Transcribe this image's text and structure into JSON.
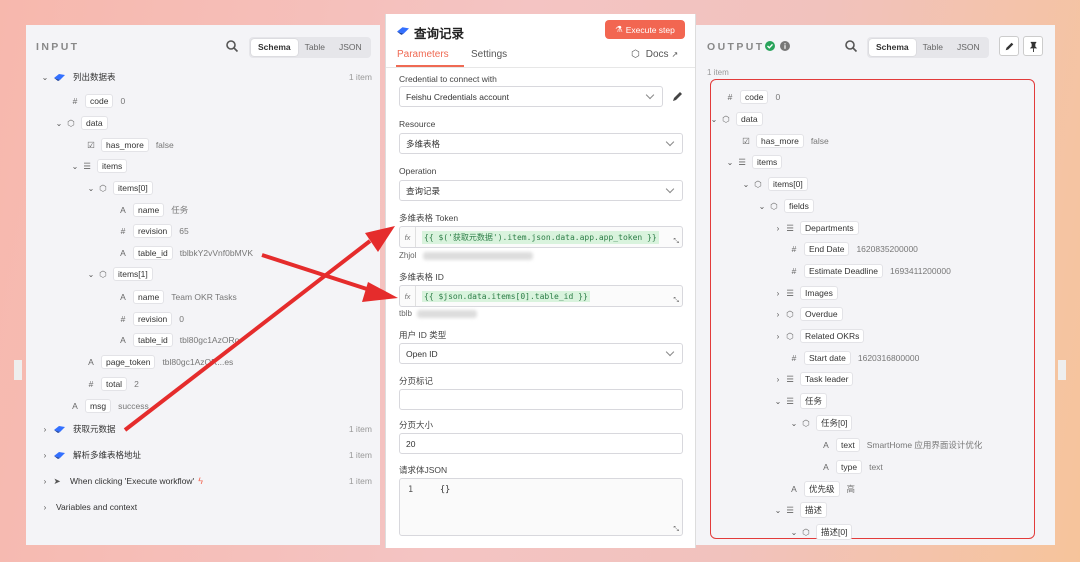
{
  "input": {
    "title": "INPUT",
    "views": [
      "Schema",
      "Table",
      "JSON"
    ],
    "nodes": [
      {
        "label": "列出数据表",
        "count": "1 item"
      },
      {
        "label": "获取元数据",
        "count": "1 item"
      },
      {
        "label": "解析多维表格地址",
        "count": "1 item"
      },
      {
        "label": "When clicking 'Execute workflow'",
        "count": "1 item"
      },
      {
        "label": "Variables and context"
      }
    ],
    "tree": {
      "code_key": "code",
      "code_val": "0",
      "data_key": "data",
      "has_more_key": "has_more",
      "has_more_val": "false",
      "items_key": "items",
      "items0_key": "items[0]",
      "name_key": "name",
      "name0_val": "任务",
      "revision_key": "revision",
      "revision0_val": "65",
      "table_id_key": "table_id",
      "table_id0_val": "tblbkY2vVnf0bMVK",
      "items1_key": "items[1]",
      "name1_val": "Team OKR Tasks",
      "revision1_val": "0",
      "table_id1_val": "tbl80gc1AzORo",
      "page_token_key": "page_token",
      "page_token_val": "tbl80gc1AzOR...es",
      "total_key": "total",
      "total_val": "2",
      "msg_key": "msg",
      "msg_val": "success"
    }
  },
  "center": {
    "title": "查询记录",
    "execute_label": "Execute step",
    "tabs": [
      "Parameters",
      "Settings"
    ],
    "docs_label": "Docs",
    "credential_label": "Credential to connect with",
    "credential_value": "Feishu Credentials account",
    "resource_label": "Resource",
    "resource_value": "多维表格",
    "operation_label": "Operation",
    "operation_value": "查询记录",
    "token_label": "多维表格 Token",
    "token_expr": "{{ $('获取元数据').item.json.data.app.app_token }}",
    "token_hint": "Zhjol",
    "table_id_label": "多维表格 ID",
    "table_id_expr": "{{ $json.data.items[0].table_id }}",
    "table_id_hint": "tblb",
    "user_id_label": "用户 ID 类型",
    "user_id_value": "Open ID",
    "page_mark_label": "分页标记",
    "page_size_label": "分页大小",
    "page_size_value": "20",
    "body_label": "请求体JSON",
    "body_line": "1",
    "body_code": "{}"
  },
  "output": {
    "title": "OUTPUT",
    "views": [
      "Schema",
      "Table",
      "JSON"
    ],
    "count": "1 item",
    "tree": {
      "code_key": "code",
      "code_val": "0",
      "data_key": "data",
      "has_more_key": "has_more",
      "has_more_val": "false",
      "items_key": "items",
      "items0_key": "items[0]",
      "fields_key": "fields",
      "departments_key": "Departments",
      "end_date_key": "End Date",
      "end_date_val": "1620835200000",
      "estimate_key": "Estimate Deadline",
      "estimate_val": "1693411200000",
      "images_key": "Images",
      "overdue_key": "Overdue",
      "okrs_key": "Related OKRs",
      "start_key": "Start date",
      "start_val": "1620316800000",
      "leader_key": "Task leader",
      "task_key": "任务",
      "task0_key": "任务[0]",
      "text_key": "text",
      "text_val": "SmartHome 应用界面设计优化",
      "type_key": "type",
      "type_val": "text",
      "priority_key": "优先级",
      "priority_val": "高",
      "desc_key": "描述",
      "desc0_key": "描述[0]"
    }
  },
  "colors": {
    "accent": "#ef6a53",
    "annotation": "#e52c2c",
    "feishu": "#3370ff"
  }
}
